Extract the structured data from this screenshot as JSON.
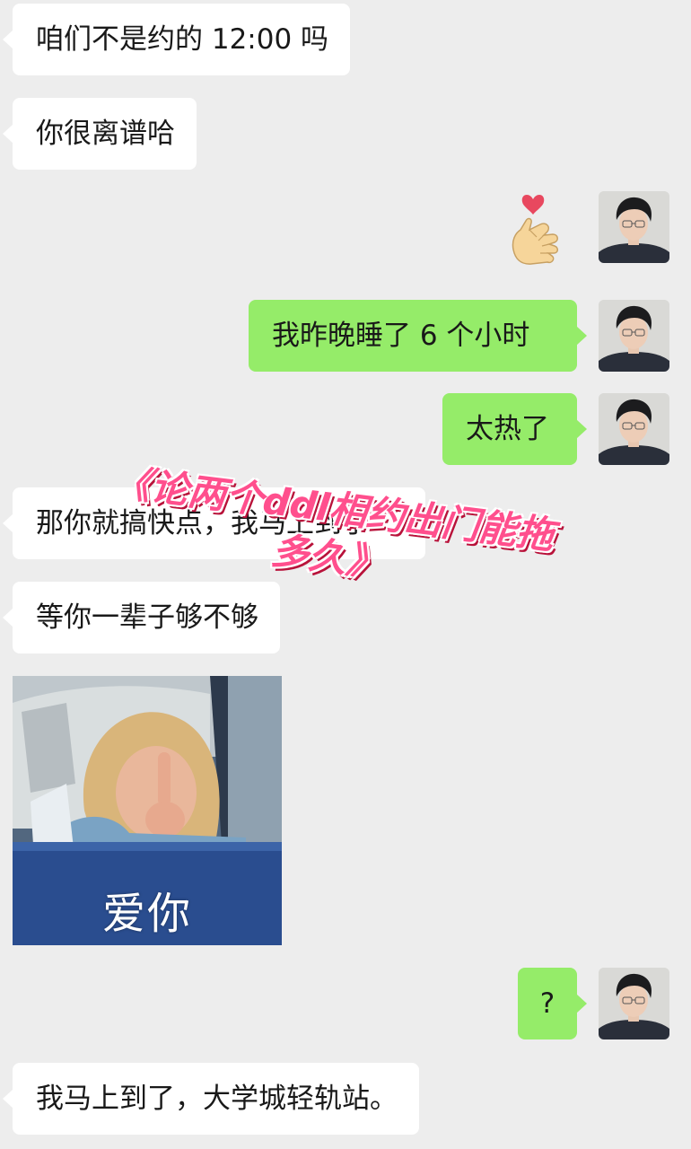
{
  "chat": {
    "messages": [
      {
        "side": "left",
        "text": "咱们不是约的 12:00 吗"
      },
      {
        "side": "left",
        "text": "你很离谱哈"
      },
      {
        "side": "right",
        "type": "sticker",
        "icon": "finger-heart-icon"
      },
      {
        "side": "right",
        "text": "我昨晚睡了 6 个小时"
      },
      {
        "side": "right",
        "text": "太热了"
      },
      {
        "side": "left",
        "text": "那你就搞快点，我马上到了"
      },
      {
        "side": "left",
        "text": "等你一辈子够不够"
      },
      {
        "side": "left",
        "type": "image",
        "caption": "爱你"
      },
      {
        "side": "right",
        "text": "?"
      },
      {
        "side": "left",
        "text": "我马上到了，大学城轻轨站。"
      }
    ]
  },
  "overlay": {
    "title": "《论两个ddl相约出门能拖多久》",
    "color": "#FF4F8D"
  },
  "colors": {
    "background": "#EDEDED",
    "left_bubble": "#FFFFFF",
    "right_bubble": "#95EC69",
    "text": "#191919"
  }
}
